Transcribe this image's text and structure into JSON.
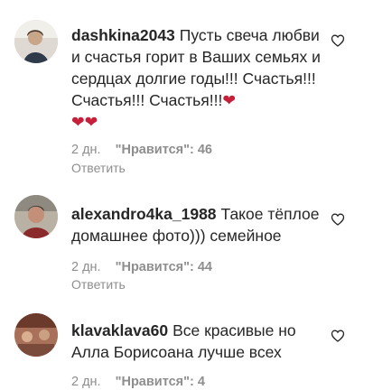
{
  "comments": [
    {
      "username": "dashkina2043",
      "text": "Пусть свеча любви и счастья горит в Ваших семьях и сердцах долгие годы!!! Счастья!!! Счастья!!! Счастья!!!",
      "emoji_tail": "❤",
      "emoji_line2": "❤❤",
      "time": "2 дн.",
      "likes": "\"Нравится\": 46",
      "reply": "Ответить"
    },
    {
      "username": "alexandro4ka_1988",
      "text": "Такое тёплое домашнее фото))) семейное",
      "time": "2 дн.",
      "likes": "\"Нравится\": 44",
      "reply": "Ответить"
    },
    {
      "username": "klavaklava60",
      "text": "Все красивые но Алла Борисоана лучше всех",
      "time": "2 дн.",
      "likes": "\"Нравится\": 4",
      "reply": "Ответить"
    }
  ],
  "colors": {
    "heart_emoji": "#c51f3a",
    "meta_text": "#8e8e8e",
    "body_text": "#262626"
  },
  "icons": {
    "like": "heart-outline-icon"
  }
}
